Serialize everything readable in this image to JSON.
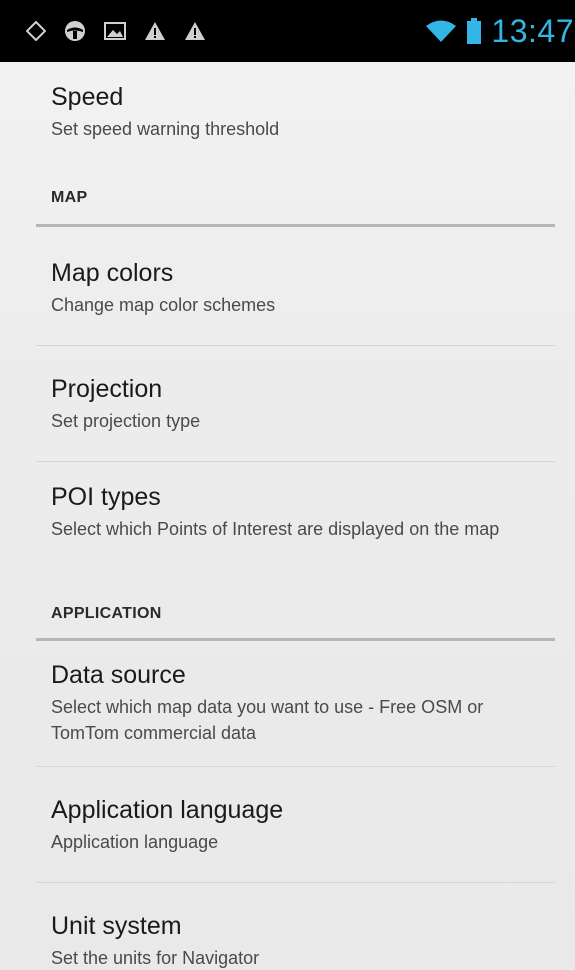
{
  "status_bar": {
    "left_icons": [
      "gps-icon",
      "steering-wheel-icon",
      "image-icon",
      "warning-icon",
      "warning-icon"
    ],
    "right_icons": [
      "wifi-icon",
      "battery-icon"
    ],
    "time": "13:47",
    "accent_color": "#33b5e5"
  },
  "settings": {
    "items": [
      {
        "title": "Speed",
        "summary": "Set speed warning threshold"
      }
    ],
    "sections": [
      {
        "header": "MAP",
        "items": [
          {
            "title": "Map colors",
            "summary": "Change map color schemes"
          },
          {
            "title": "Projection",
            "summary": "Set projection type"
          },
          {
            "title": "POI types",
            "summary": "Select which Points of Interest are displayed on the map"
          }
        ]
      },
      {
        "header": "APPLICATION",
        "items": [
          {
            "title": "Data source",
            "summary": "Select which map data you want to use - Free OSM or TomTom commercial data"
          },
          {
            "title": "Application language",
            "summary": "Application language"
          },
          {
            "title": "Unit system",
            "summary": "Set the units for Navigator"
          }
        ]
      }
    ]
  }
}
